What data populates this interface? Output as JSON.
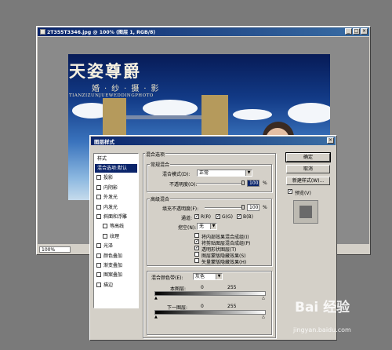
{
  "document_window": {
    "title": "2T355T3346.jpg @ 100% (图层 1, RGB/8)",
    "zoom": "100%",
    "buttons": [
      "_",
      "□",
      "×"
    ]
  },
  "photo": {
    "title": "天姿尊爵",
    "subtitle": "婚·纱·摄·影",
    "english": "TIANZIZUNJUEWEDDINGPHOTO"
  },
  "dialog": {
    "title": "图层样式",
    "close": "×",
    "style_list": {
      "header": "样式",
      "items": [
        {
          "label": "混合选项:默认",
          "checkbox": false,
          "selected": true
        },
        {
          "label": "投影",
          "checkbox": true
        },
        {
          "label": "内阴影",
          "checkbox": true
        },
        {
          "label": "外发光",
          "checkbox": true
        },
        {
          "label": "内发光",
          "checkbox": true
        },
        {
          "label": "斜面和浮雕",
          "checkbox": true
        },
        {
          "label": "等高线",
          "checkbox": true,
          "indent": true
        },
        {
          "label": "纹理",
          "checkbox": true,
          "indent": true
        },
        {
          "label": "光泽",
          "checkbox": true
        },
        {
          "label": "颜色叠加",
          "checkbox": true
        },
        {
          "label": "渐变叠加",
          "checkbox": true
        },
        {
          "label": "图案叠加",
          "checkbox": true
        },
        {
          "label": "描边",
          "checkbox": true
        }
      ]
    },
    "blend_options": {
      "title": "混合选项",
      "general": {
        "title": "常规混合",
        "mode_label": "混合模式(D):",
        "mode_value": "正常",
        "opacity_label": "不透明度(O):",
        "opacity_value": "100",
        "opacity_unit": "%"
      },
      "advanced": {
        "title": "高级混合",
        "fill_label": "填充不透明度(F):",
        "fill_value": "100",
        "fill_unit": "%",
        "channels_label": "通道:",
        "channels": [
          "R(R)",
          "G(G)",
          "B(B)"
        ],
        "knockout_label": "挖空(N):",
        "knockout_value": "无",
        "options": [
          {
            "label": "将内部效果混合成组(I)",
            "checked": false
          },
          {
            "label": "将剪贴图层混合成组(P)",
            "checked": true
          },
          {
            "label": "透明形状图层(T)",
            "checked": true
          },
          {
            "label": "图层蒙版隐藏效果(S)",
            "checked": false
          },
          {
            "label": "矢量蒙版隐藏效果(H)",
            "checked": false
          }
        ]
      },
      "blend_if": {
        "label": "混合颜色带(E):",
        "value": "灰色",
        "this_layer_label": "本图层:",
        "this_layer_min": "0",
        "this_layer_max": "255",
        "under_layer_label": "下一图层:",
        "under_layer_min": "0",
        "under_layer_max": "255"
      }
    },
    "buttons": {
      "ok": "确定",
      "cancel": "取消",
      "new_style": "新建样式(W)...",
      "preview_label": "预览(V)",
      "preview_checked": true
    }
  },
  "watermark": {
    "text": "Bai 经验",
    "url": "jingyan.baidu.com"
  }
}
